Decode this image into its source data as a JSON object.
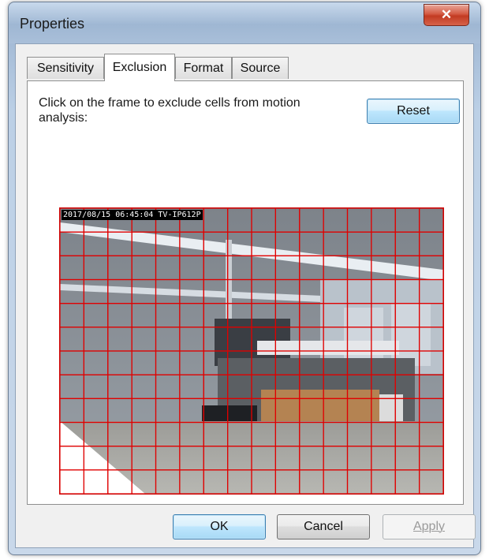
{
  "window": {
    "title": "Properties",
    "close_glyph": "✕"
  },
  "tabs": [
    {
      "label": "Sensitivity",
      "active": false
    },
    {
      "label": "Exclusion",
      "active": true
    },
    {
      "label": "Format",
      "active": false
    },
    {
      "label": "Source",
      "active": false
    }
  ],
  "exclusion": {
    "instruction": "Click on the frame to exclude cells from motion analysis:",
    "reset_label": "Reset",
    "overlay_text": "2017/08/15 06:45:04 TV-IP612P",
    "grid": {
      "columns": 16,
      "rows": 12,
      "line_color": "#e00000",
      "excluded_cells": [
        [
          9,
          0
        ],
        [
          10,
          0
        ],
        [
          10,
          1
        ],
        [
          11,
          0
        ],
        [
          11,
          1
        ],
        [
          11,
          2
        ]
      ]
    }
  },
  "footer": {
    "ok_label": "OK",
    "cancel_label": "Cancel",
    "apply_label": "Apply"
  },
  "colors": {
    "accent": "#3c7fb1",
    "close": "#c23b22",
    "grid": "#e00000"
  }
}
